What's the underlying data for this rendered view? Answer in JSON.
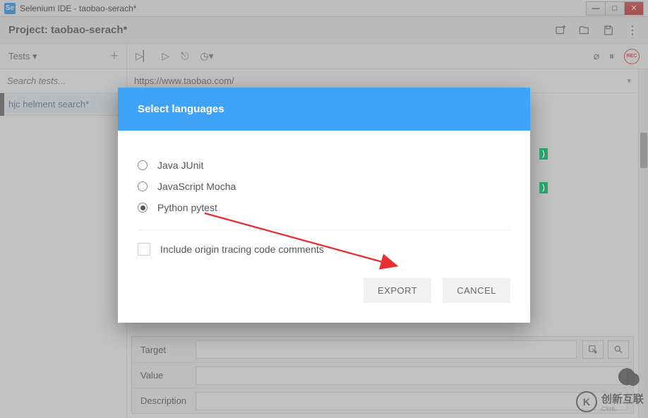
{
  "window": {
    "icon_label": "Se",
    "title": "Selenium IDE - taobao-serach*"
  },
  "project": {
    "label": "Project:  taobao-serach*"
  },
  "sidebar": {
    "tests_label": "Tests",
    "search_placeholder": "Search tests...",
    "tests": [
      {
        "name": "hjc helment search*"
      }
    ]
  },
  "url": "https://www.taobao.com/",
  "command_form": {
    "rows": [
      {
        "label": "Target"
      },
      {
        "label": "Value"
      },
      {
        "label": "Description"
      }
    ]
  },
  "dialog": {
    "title": "Select languages",
    "options": [
      {
        "label": "Java JUnit",
        "checked": false
      },
      {
        "label": "JavaScript Mocha",
        "checked": false
      },
      {
        "label": "Python pytest",
        "checked": true
      }
    ],
    "include_label": "Include origin tracing code comments",
    "export_label": "EXPORT",
    "cancel_label": "CANCEL"
  },
  "watermark": {
    "brand": "创新互联",
    "sub": "CXHL"
  }
}
